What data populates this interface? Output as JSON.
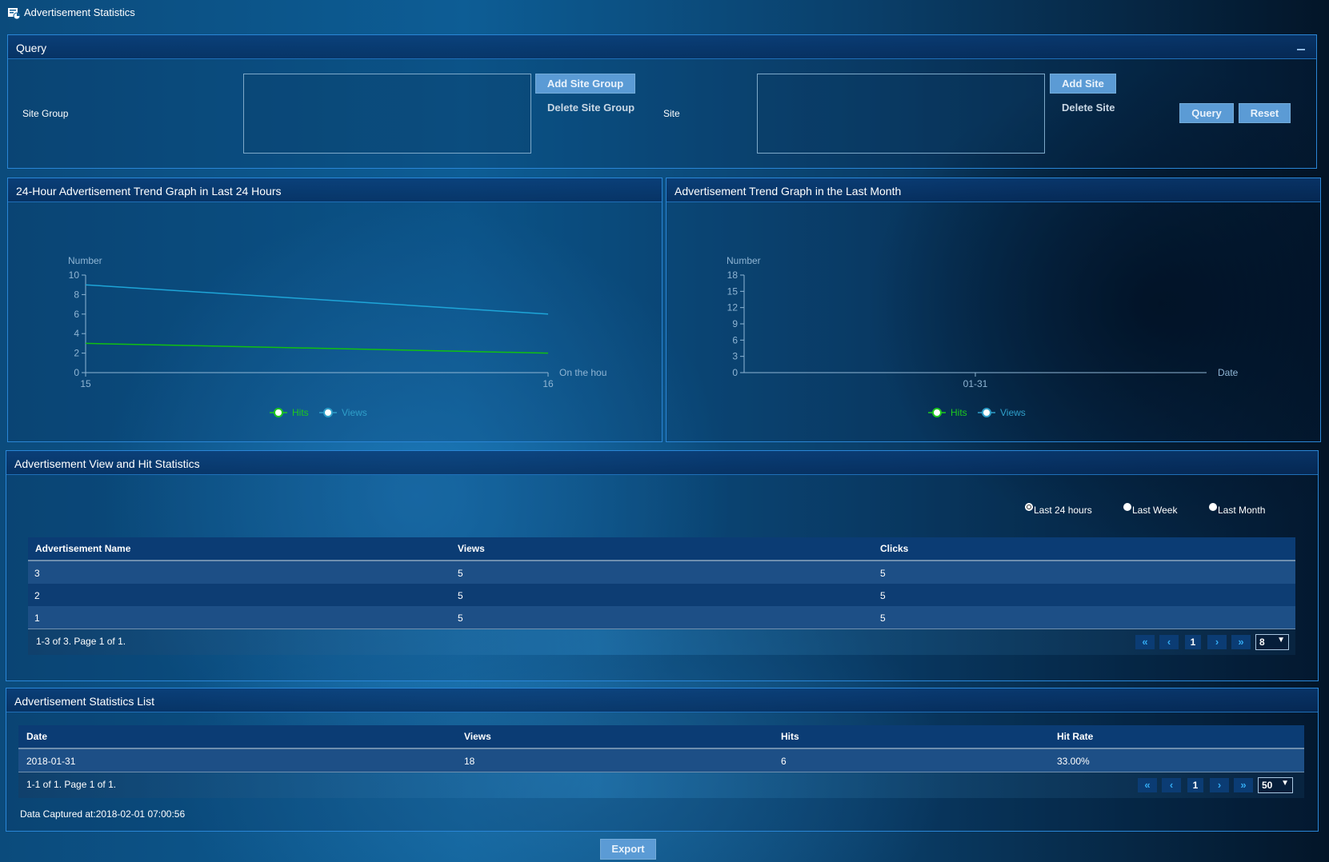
{
  "page": {
    "title": "Advertisement Statistics"
  },
  "query": {
    "title": "Query",
    "site_group_label": "Site Group",
    "add_site_group": "Add Site Group",
    "delete_site_group": "Delete Site Group",
    "site_label": "Site",
    "add_site": "Add Site",
    "delete_site": "Delete Site",
    "query_btn": "Query",
    "reset_btn": "Reset"
  },
  "chart_data": [
    {
      "type": "line",
      "title": "24-Hour Advertisement Trend Graph in Last 24 Hours",
      "ylabel": "Number",
      "xlabel": "On the hou",
      "x": [
        "15",
        "16"
      ],
      "ylim": [
        0,
        10
      ],
      "yticks": [
        "0",
        "2",
        "4",
        "6",
        "8",
        "10"
      ],
      "series": [
        {
          "name": "Hits",
          "values": [
            3,
            2
          ],
          "color": "#11c011"
        },
        {
          "name": "Views",
          "values": [
            9,
            6
          ],
          "color": "#1ea5d8"
        }
      ],
      "legend": "bottom-center",
      "legend_colors": {
        "Hits": "#1ec91e",
        "Views": "#2f9fc9"
      }
    },
    {
      "type": "line",
      "title": "Advertisement Trend Graph in the Last Month",
      "ylabel": "Number",
      "xlabel": "Date",
      "x": [
        "01-31"
      ],
      "ylim": [
        0,
        18
      ],
      "yticks": [
        "0",
        "3",
        "6",
        "9",
        "12",
        "15",
        "18"
      ],
      "series": [
        {
          "name": "Hits",
          "values": [],
          "color": "#11c011"
        },
        {
          "name": "Views",
          "values": [],
          "color": "#1ea5d8"
        }
      ],
      "legend": "bottom-center",
      "legend_colors": {
        "Hits": "#1ec91e",
        "Views": "#2f9fc9"
      }
    }
  ],
  "view_hit": {
    "title": "Advertisement View and Hit Statistics",
    "radios": [
      "Last 24 hours",
      "Last Week",
      "Last Month"
    ],
    "selected": "Last 24 hours",
    "columns": [
      "Advertisement Name",
      "Views",
      "Clicks"
    ],
    "rows": [
      [
        "3",
        "5",
        "5"
      ],
      [
        "2",
        "5",
        "5"
      ],
      [
        "1",
        "5",
        "5"
      ]
    ],
    "footer": "1-3 of 3. Page 1 of 1.",
    "page": "1",
    "page_size": "8"
  },
  "stats_list": {
    "title": "Advertisement Statistics List",
    "columns": [
      "Date",
      "Views",
      "Hits",
      "Hit Rate"
    ],
    "rows": [
      [
        "2018-01-31",
        "18",
        "6",
        "33.00%"
      ]
    ],
    "footer": "1-1 of 1. Page 1 of 1.",
    "page": "1",
    "page_size": "50",
    "captured": "Data Captured at:2018-02-01 07:00:56"
  },
  "export_btn": "Export",
  "pager_icons": {
    "first": "«",
    "prev": "‹",
    "next": "›",
    "last": "»",
    "dropdown": "▼"
  }
}
